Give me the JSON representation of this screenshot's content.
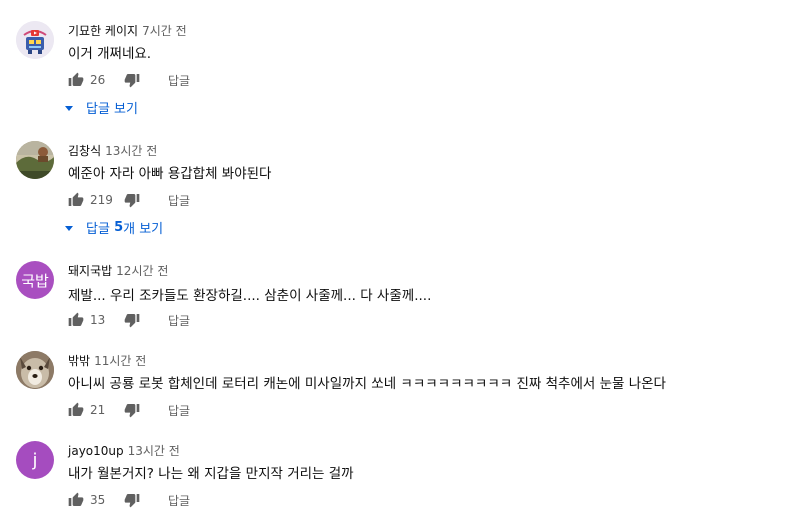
{
  "comments": [
    {
      "author": "기묘한 케이지",
      "time": "7시간 전",
      "text": "이거 개쩌네요.",
      "likes": "26",
      "reply": "답글",
      "view_replies": "답글 보기",
      "avatar": {
        "type": "robot-logo",
        "bg": "#e8e4ef"
      }
    },
    {
      "author": "김창식",
      "time": "13시간 전",
      "text": "예준아 자라 아빠 용갑합체 봐야된다",
      "likes": "219",
      "reply": "답글",
      "view_replies_prefix": "답글 ",
      "view_replies_count": "5",
      "view_replies_suffix": "개 보기",
      "avatar": {
        "type": "photo-landscape",
        "bg": "#8a7a58"
      }
    },
    {
      "author": "돼지국밥",
      "time": "12시간 전",
      "text": "제발... 우리 조카들도 환장하길.... 삼춘이 사줄께... 다 사줄께....",
      "likes": "13",
      "reply": "답글",
      "avatar": {
        "type": "initials",
        "initials": "국밥",
        "bg": "#a94fc0"
      }
    },
    {
      "author": "밖밖",
      "time": "11시간 전",
      "text": "아니씨 공룡 로봇 합체인데 로터리 캐논에 미사일까지 쏘네 ㅋㅋㅋㅋㅋㅋㅋㅋㅋ 진짜 척추에서 눈물 나온다",
      "likes": "21",
      "reply": "답글",
      "avatar": {
        "type": "photo-dog",
        "bg": "#7b6a5c"
      }
    },
    {
      "author": "jayo10up",
      "time": "13시간 전",
      "text": "내가 월본거지? 나는 왜 지갑을 만지작 거리는 걸까",
      "likes": "35",
      "reply": "답글",
      "avatar": {
        "type": "initials",
        "initials": "j",
        "bg": "#a54cbf"
      }
    }
  ],
  "colors": {
    "link": "#065fd4",
    "secondary": "#606060",
    "text": "#0f0f0f"
  },
  "icons": {
    "like": "thumbs-up-icon",
    "dislike": "thumbs-down-icon",
    "expand": "caret-down-icon"
  }
}
